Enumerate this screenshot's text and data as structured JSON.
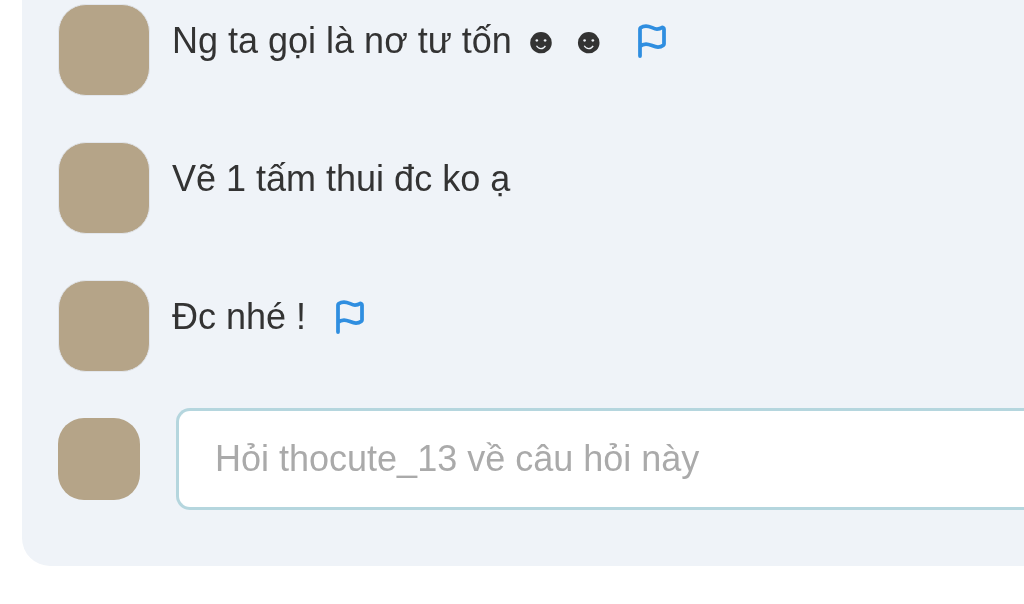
{
  "comments": [
    {
      "text": "Ng ta gọi là nơ tư tốn ☻ ☻",
      "flagged": true
    },
    {
      "text": "Vẽ 1 tấm thui đc ko ạ",
      "flagged": false
    },
    {
      "text": "Đc nhé !",
      "flagged": true
    }
  ],
  "reply": {
    "placeholder": "Hỏi thocute_13 về câu hỏi này"
  }
}
